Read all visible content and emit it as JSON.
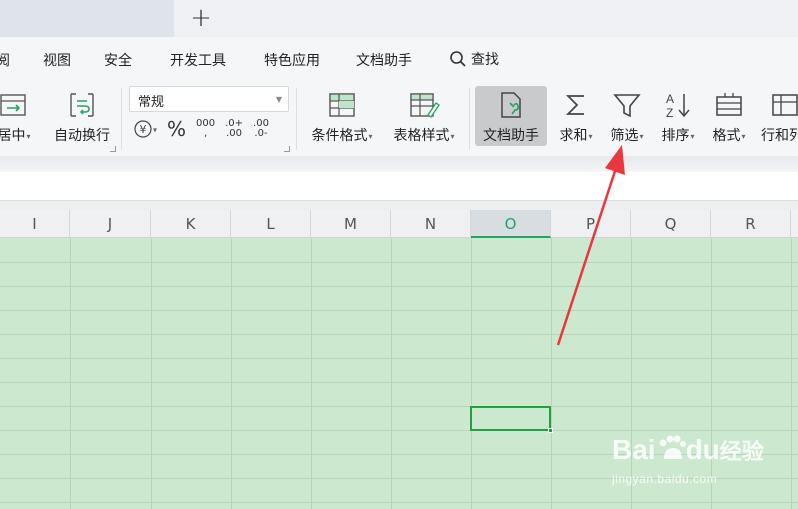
{
  "tabbar": {
    "new_tab": "+"
  },
  "menu": {
    "items": [
      "阅",
      "视图",
      "安全",
      "开发工具",
      "特色应用",
      "文档助手"
    ],
    "search_label": "查找"
  },
  "ribbon": {
    "merge_center": "居中",
    "wrap_text": "自动换行",
    "number_format": "常规",
    "currency": "¥",
    "percent": "%",
    "thousands": "000",
    "thousands_sub": ",",
    "inc_decimal_top": ".0+",
    "inc_decimal_bottom": ".00",
    "dec_decimal_top": ".00",
    "dec_decimal_bottom": ".0-",
    "conditional_format": "条件格式",
    "table_style": "表格样式",
    "doc_helper": "文档助手",
    "sum": "求和",
    "filter": "筛选",
    "sort": "排序",
    "format": "格式",
    "row_col": "行和列"
  },
  "grid": {
    "columns": [
      "I",
      "J",
      "K",
      "L",
      "M",
      "N",
      "O",
      "P",
      "Q",
      "R"
    ],
    "active_column": "O"
  },
  "watermark": {
    "brand": "Bai",
    "brand_suffix": "du",
    "cn": "经验",
    "url": "jingyan.baidu.com"
  },
  "colors": {
    "sheet_bg": "#cce8cf",
    "accent_green": "#21a366",
    "arrow_red": "#e8383d"
  }
}
